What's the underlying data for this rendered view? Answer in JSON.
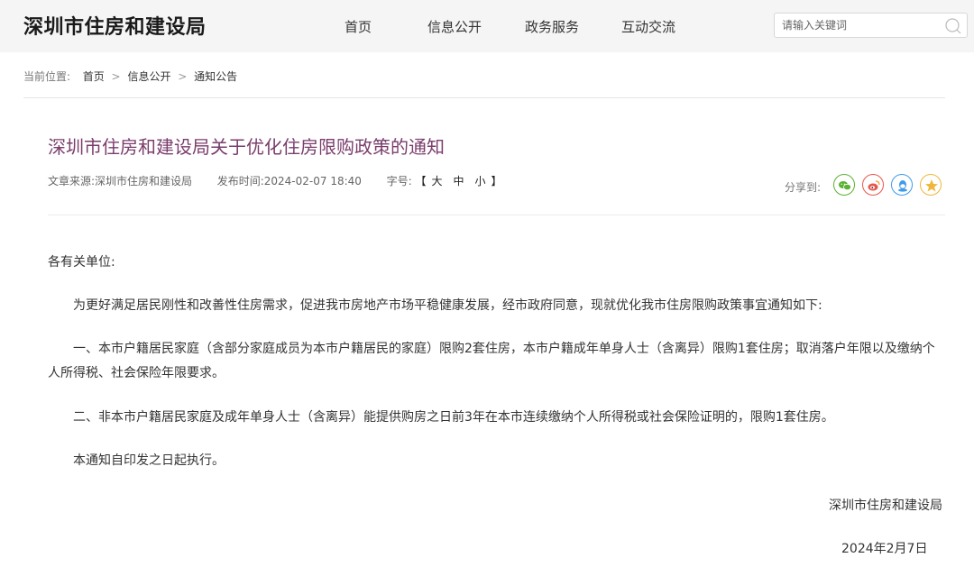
{
  "header": {
    "site_title": "深圳市住房和建设局",
    "nav": [
      "首页",
      "信息公开",
      "政务服务",
      "互动交流"
    ],
    "search_placeholder": "请输入关键词"
  },
  "breadcrumb": {
    "label": "当前位置:",
    "items": [
      "首页",
      "信息公开",
      "通知公告"
    ],
    "separator": ">"
  },
  "article": {
    "title": "深圳市住房和建设局关于优化住房限购政策的通知",
    "source_label": "文章来源:",
    "source": "深圳市住房和建设局",
    "time_label": "发布时间:",
    "time": "2024-02-07 18:40",
    "font_label": "字号:",
    "bracket_open": "【",
    "font_sizes": [
      "大",
      "中",
      "小"
    ],
    "bracket_close": "】",
    "share_label": "分享到:",
    "share_icons": [
      "wechat-icon",
      "weibo-icon",
      "qq-icon",
      "qzone-icon"
    ],
    "salutation": "各有关单位:",
    "paragraphs": [
      "为更好满足居民刚性和改善性住房需求，促进我市房地产市场平稳健康发展，经市政府同意，现就优化我市住房限购政策事宜通知如下:",
      "一、本市户籍居民家庭（含部分家庭成员为本市户籍居民的家庭）限购2套住房，本市户籍成年单身人士（含离异）限购1套住房；取消落户年限以及缴纳个人所得税、社会保险年限要求。",
      "二、非本市户籍居民家庭及成年单身人士（含离异）能提供购房之日前3年在本市连续缴纳个人所得税或社会保险证明的，限购1套住房。",
      "本通知自印发之日起执行。"
    ],
    "signature": "深圳市住房和建设局",
    "date": "2024年2月7日"
  },
  "colors": {
    "title": "#7a3d6c",
    "wechat": "#5bb130",
    "weibo": "#e8574c",
    "qq": "#3d9be9",
    "qzone": "#f0b63a"
  }
}
